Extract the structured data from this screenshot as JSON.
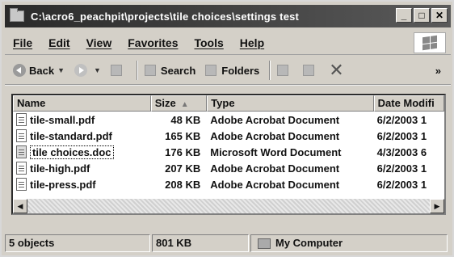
{
  "window": {
    "title": "C:\\acro6_peachpit\\projects\\tile choices\\settings test",
    "buttons": {
      "minimize": "_",
      "maximize": "□",
      "close": "✕"
    }
  },
  "menu": [
    "File",
    "Edit",
    "View",
    "Favorites",
    "Tools",
    "Help"
  ],
  "toolbar": {
    "back": "Back",
    "search": "Search",
    "folders": "Folders",
    "more": "»"
  },
  "list": {
    "columns": {
      "name": "Name",
      "size": "Size",
      "type": "Type",
      "date": "Date Modifi"
    },
    "rows": [
      {
        "name": "tile-small.pdf",
        "size": "48 KB",
        "type": "Adobe Acrobat Document",
        "date": "6/2/2003 1"
      },
      {
        "name": "tile-standard.pdf",
        "size": "165 KB",
        "type": "Adobe Acrobat Document",
        "date": "6/2/2003 1"
      },
      {
        "name": "tile choices.doc",
        "size": "176 KB",
        "type": "Microsoft Word Document",
        "date": "4/3/2003 6"
      },
      {
        "name": "tile-high.pdf",
        "size": "207 KB",
        "type": "Adobe Acrobat Document",
        "date": "6/2/2003 1"
      },
      {
        "name": "tile-press.pdf",
        "size": "208 KB",
        "type": "Adobe Acrobat Document",
        "date": "6/2/2003 1"
      }
    ]
  },
  "status": {
    "objects": "5 objects",
    "size": "801 KB",
    "location": "My Computer"
  }
}
